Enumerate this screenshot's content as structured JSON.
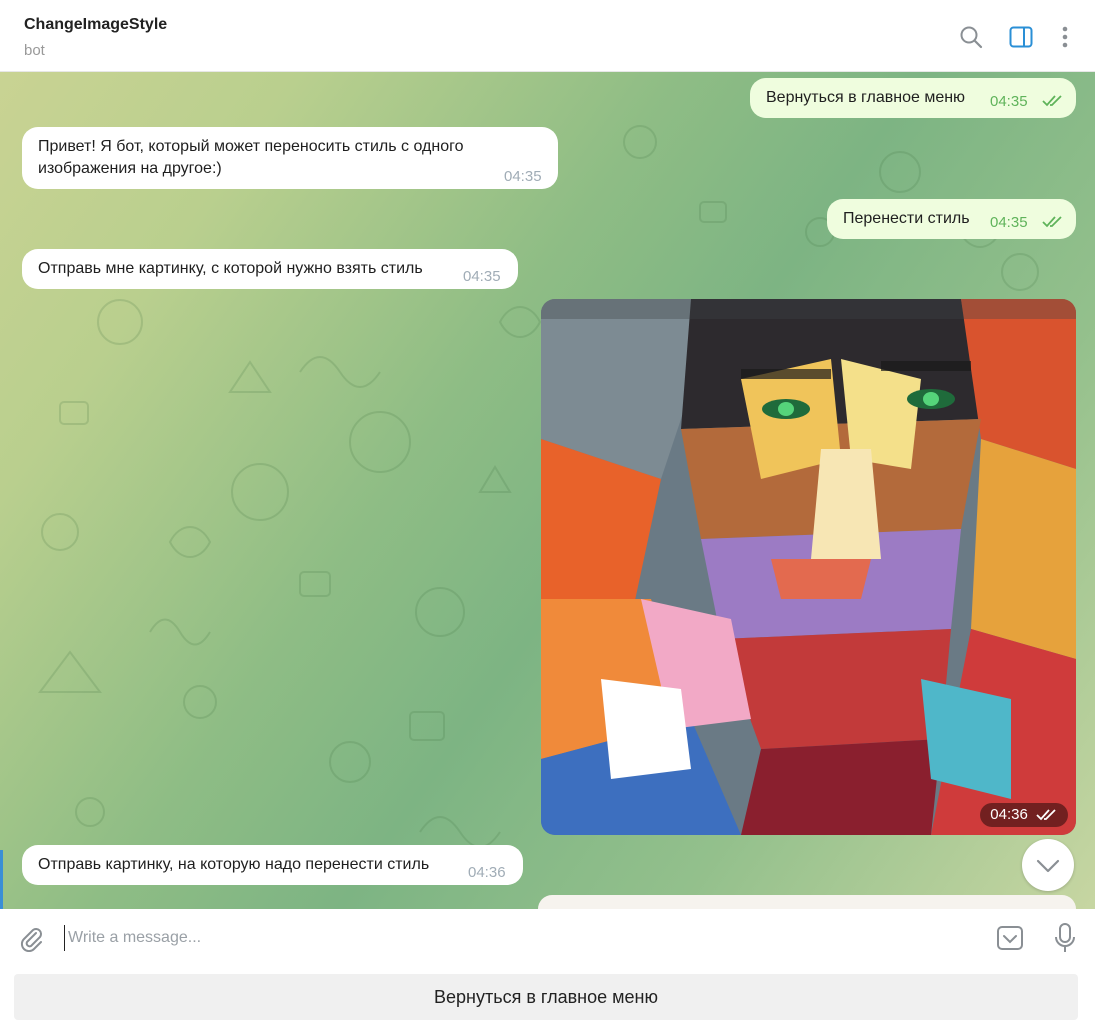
{
  "header": {
    "title": "ChangeImageStyle",
    "subtitle": "bot",
    "icons": [
      "search-icon",
      "sidebar-toggle-icon",
      "more-vertical-icon"
    ],
    "accent_color": "#2a8fd6"
  },
  "messages": [
    {
      "direction": "out",
      "text": "Вернуться в главное меню",
      "time": "04:35",
      "read": true
    },
    {
      "direction": "in",
      "text": "Привет! Я бот, который может переносить стиль с одного изображения на другое:)",
      "time": "04:35"
    },
    {
      "direction": "out",
      "text": "Перенести стиль",
      "time": "04:35",
      "read": true
    },
    {
      "direction": "in",
      "text": "Отправь мне картинку, с которой нужно взять стиль",
      "time": "04:35"
    },
    {
      "direction": "out",
      "type": "photo",
      "description_icon": "painted-portrait-image",
      "time": "04:36",
      "read": true
    },
    {
      "direction": "in",
      "text": "Отправь картинку, на которую надо перенести стиль",
      "time": "04:36"
    }
  ],
  "input": {
    "placeholder": "Write a message..."
  },
  "reply_keyboard": {
    "button_label": "Вернуться в главное меню"
  },
  "colors": {
    "outgoing_bubble": "#effdde",
    "incoming_bubble": "#ffffff",
    "read_check": "#5fb35a"
  }
}
